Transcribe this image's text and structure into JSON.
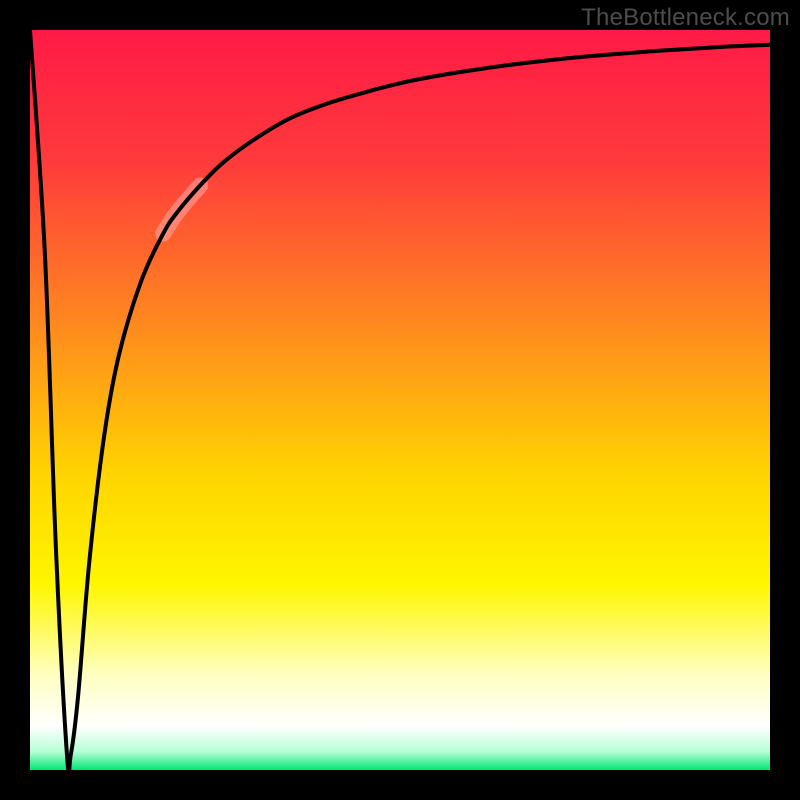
{
  "watermark": "TheBottleneck.com",
  "colors": {
    "frame": "#000000",
    "watermark_text": "#4d4d4d",
    "gradient_stops": [
      {
        "offset": 0.0,
        "color": "#ff1a46"
      },
      {
        "offset": 0.18,
        "color": "#ff3b3b"
      },
      {
        "offset": 0.4,
        "color": "#ff8a1e"
      },
      {
        "offset": 0.6,
        "color": "#ffd400"
      },
      {
        "offset": 0.75,
        "color": "#fff600"
      },
      {
        "offset": 0.87,
        "color": "#ffffc0"
      },
      {
        "offset": 0.94,
        "color": "#ffffff"
      },
      {
        "offset": 0.975,
        "color": "#b8ffd5"
      },
      {
        "offset": 1.0,
        "color": "#00e676"
      }
    ],
    "curve": "#000000",
    "highlight": "rgba(255,170,170,0.55)"
  },
  "chart_data": {
    "type": "line",
    "title": "",
    "xlabel": "",
    "ylabel": "",
    "xlim": [
      0,
      100
    ],
    "ylim": [
      0,
      100
    ],
    "grid": false,
    "legend": false,
    "description": "Bottleneck-style curve: rapid drop near x≈5 to ≈0, then rises with diminishing slope toward ≈98 at the right edge. A short pale segment highlights x≈18–23 on the rising limb.",
    "series": [
      {
        "name": "curve",
        "x": [
          0,
          2,
          3.5,
          5,
          5.5,
          6.5,
          8,
          10,
          12,
          15,
          18,
          20,
          23,
          26,
          30,
          35,
          40,
          45,
          50,
          55,
          60,
          65,
          70,
          75,
          80,
          85,
          90,
          95,
          100
        ],
        "y": [
          100,
          70,
          30,
          2,
          2,
          10,
          28,
          45,
          56,
          66,
          72.5,
          75.5,
          79,
          82,
          85,
          88,
          90,
          91.5,
          92.8,
          93.8,
          94.6,
          95.3,
          95.9,
          96.4,
          96.8,
          97.2,
          97.5,
          97.8,
          98
        ]
      }
    ],
    "highlight_segment": {
      "x_start": 18,
      "x_end": 23
    }
  }
}
